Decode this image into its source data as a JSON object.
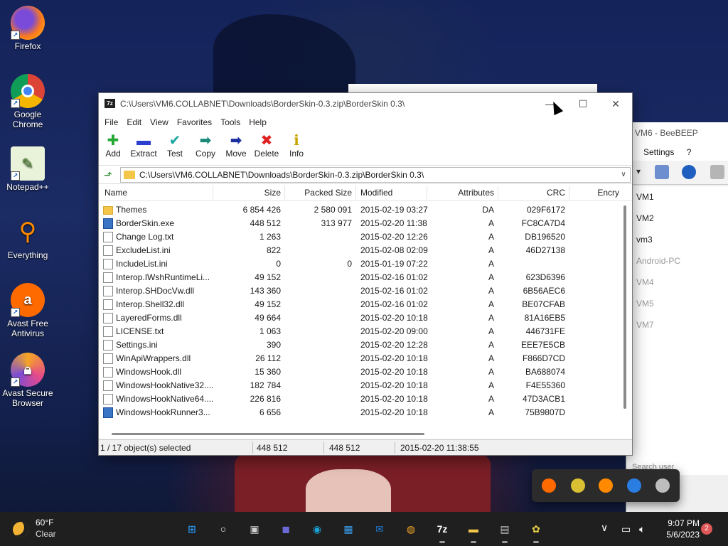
{
  "desktop": {
    "icons": [
      {
        "label": "Firefox"
      },
      {
        "label": "Google Chrome"
      },
      {
        "label": "Notepad++"
      },
      {
        "label": "Everything"
      },
      {
        "label": "Avast Free Antivirus"
      },
      {
        "label": "Avast Secure Browser"
      }
    ]
  },
  "beebeep": {
    "title": "VM6 - BeeBEEP",
    "menu": [
      "Settings",
      "?"
    ],
    "users": [
      {
        "name": "VM1",
        "online": true
      },
      {
        "name": "VM2",
        "online": true
      },
      {
        "name": "vm3",
        "online": true
      },
      {
        "name": "Android-PC",
        "online": false
      },
      {
        "name": "VM4",
        "online": false
      },
      {
        "name": "VM5",
        "online": false
      },
      {
        "name": "VM7",
        "online": false
      }
    ],
    "search_placeholder": "Search user"
  },
  "window": {
    "title": "C:\\Users\\VM6.COLLABNET\\Downloads\\BorderSkin-0.3.zip\\BorderSkin 0.3\\",
    "app_icon": "7z",
    "controls": {
      "minimize": "—",
      "maximize": "☐",
      "close": "✕"
    },
    "menu": [
      "File",
      "Edit",
      "View",
      "Favorites",
      "Tools",
      "Help"
    ],
    "toolbar": [
      {
        "label": "Add",
        "icon": "plus-icon",
        "glyph": "✚",
        "color": "#22a833"
      },
      {
        "label": "Extract",
        "icon": "minus-icon",
        "glyph": "▬",
        "color": "#2a3fd0"
      },
      {
        "label": "Test",
        "icon": "check-icon",
        "glyph": "✔",
        "color": "#1aa5a0"
      },
      {
        "label": "Copy",
        "icon": "copy-arrow-icon",
        "glyph": "➡",
        "color": "#1a8a78"
      },
      {
        "label": "Move",
        "icon": "move-arrow-icon",
        "glyph": "➡",
        "color": "#1c2fa0"
      },
      {
        "label": "Delete",
        "icon": "delete-x-icon",
        "glyph": "✖",
        "color": "#e02020"
      },
      {
        "label": "Info",
        "icon": "info-icon",
        "glyph": "ℹ",
        "color": "#c9a400"
      }
    ],
    "address": "C:\\Users\\VM6.COLLABNET\\Downloads\\BorderSkin-0.3.zip\\BorderSkin 0.3\\",
    "columns": [
      "Name",
      "Size",
      "Packed Size",
      "Modified",
      "Attributes",
      "CRC",
      "Encry"
    ],
    "files": [
      {
        "name": "Themes",
        "type": "folder",
        "size": "6 854 426",
        "packed": "2 580 091",
        "modified": "2015-02-19 03:27",
        "attr": "DA",
        "crc": "029F6172"
      },
      {
        "name": "BorderSkin.exe",
        "type": "exe",
        "size": "448 512",
        "packed": "313 977",
        "modified": "2015-02-20 11:38",
        "attr": "A",
        "crc": "FC8CA7D4"
      },
      {
        "name": "Change Log.txt",
        "type": "file",
        "size": "1 263",
        "packed": "",
        "modified": "2015-02-20 12:26",
        "attr": "A",
        "crc": "DB196520"
      },
      {
        "name": "ExcludeList.ini",
        "type": "file",
        "size": "822",
        "packed": "",
        "modified": "2015-02-08 02:09",
        "attr": "A",
        "crc": "46D27138"
      },
      {
        "name": "IncludeList.ini",
        "type": "file",
        "size": "0",
        "packed": "0",
        "modified": "2015-01-19 07:22",
        "attr": "A",
        "crc": ""
      },
      {
        "name": "Interop.IWshRuntimeLi...",
        "type": "file",
        "size": "49 152",
        "packed": "",
        "modified": "2015-02-16 01:02",
        "attr": "A",
        "crc": "623D6396"
      },
      {
        "name": "Interop.SHDocVw.dll",
        "type": "file",
        "size": "143 360",
        "packed": "",
        "modified": "2015-02-16 01:02",
        "attr": "A",
        "crc": "6B56AEC6"
      },
      {
        "name": "Interop.Shell32.dll",
        "type": "file",
        "size": "49 152",
        "packed": "",
        "modified": "2015-02-16 01:02",
        "attr": "A",
        "crc": "BE07CFAB"
      },
      {
        "name": "LayeredForms.dll",
        "type": "file",
        "size": "49 664",
        "packed": "",
        "modified": "2015-02-20 10:18",
        "attr": "A",
        "crc": "81A16EB5"
      },
      {
        "name": "LICENSE.txt",
        "type": "file",
        "size": "1 063",
        "packed": "",
        "modified": "2015-02-20 09:00",
        "attr": "A",
        "crc": "446731FE"
      },
      {
        "name": "Settings.ini",
        "type": "file",
        "size": "390",
        "packed": "",
        "modified": "2015-02-20 12:28",
        "attr": "A",
        "crc": "EEE7E5CB"
      },
      {
        "name": "WinApiWrappers.dll",
        "type": "file",
        "size": "26 112",
        "packed": "",
        "modified": "2015-02-20 10:18",
        "attr": "A",
        "crc": "F866D7CD"
      },
      {
        "name": "WindowsHook.dll",
        "type": "file",
        "size": "15 360",
        "packed": "",
        "modified": "2015-02-20 10:18",
        "attr": "A",
        "crc": "BA688074"
      },
      {
        "name": "WindowsHookNative32....",
        "type": "file",
        "size": "182 784",
        "packed": "",
        "modified": "2015-02-20 10:18",
        "attr": "A",
        "crc": "F4E55360"
      },
      {
        "name": "WindowsHookNative64....",
        "type": "file",
        "size": "226 816",
        "packed": "",
        "modified": "2015-02-20 10:18",
        "attr": "A",
        "crc": "47D3ACB1"
      },
      {
        "name": "WindowsHookRunner3...",
        "type": "exe",
        "size": "6 656",
        "packed": "",
        "modified": "2015-02-20 10:18",
        "attr": "A",
        "crc": "75B9807D"
      }
    ],
    "status": {
      "selection": "1 / 17 object(s) selected",
      "size": "448 512",
      "packed": "448 512",
      "modified": "2015-02-20 11:38:55"
    }
  },
  "taskbar": {
    "weather": {
      "temp": "60°F",
      "condition": "Clear"
    },
    "time": "9:07 PM",
    "date": "5/6/2023",
    "notifications": "2",
    "apps": [
      {
        "name": "start",
        "glyph": "⊞",
        "color": "#2b8fe8"
      },
      {
        "name": "search",
        "glyph": "○",
        "color": "#ffffff"
      },
      {
        "name": "task-view",
        "glyph": "▣",
        "color": "#cfcfcf"
      },
      {
        "name": "chat",
        "glyph": "◼",
        "color": "#6b69d6"
      },
      {
        "name": "edge",
        "glyph": "◉",
        "color": "#1aa3d6"
      },
      {
        "name": "store",
        "glyph": "▦",
        "color": "#3aa0f0"
      },
      {
        "name": "mail",
        "glyph": "✉",
        "color": "#1f7ad6"
      },
      {
        "name": "avast-browser",
        "glyph": "◍",
        "color": "#f5a623"
      },
      {
        "name": "7zip",
        "glyph": "7z",
        "color": "#ffffff"
      },
      {
        "name": "file-explorer",
        "glyph": "▬",
        "color": "#f3c549"
      },
      {
        "name": "notepad",
        "glyph": "▤",
        "color": "#bfbfbf"
      },
      {
        "name": "beebeep",
        "glyph": "✿",
        "color": "#e8d24a"
      }
    ],
    "tray_chevron": "∨"
  },
  "tray_popup": [
    {
      "name": "avast",
      "color": "#ff6a00"
    },
    {
      "name": "beebeep",
      "color": "#d9c032"
    },
    {
      "name": "everything",
      "color": "#ff8a00"
    },
    {
      "name": "defender",
      "color": "#2a7de1"
    },
    {
      "name": "hidden-app",
      "color": "#bdbdbd"
    }
  ]
}
